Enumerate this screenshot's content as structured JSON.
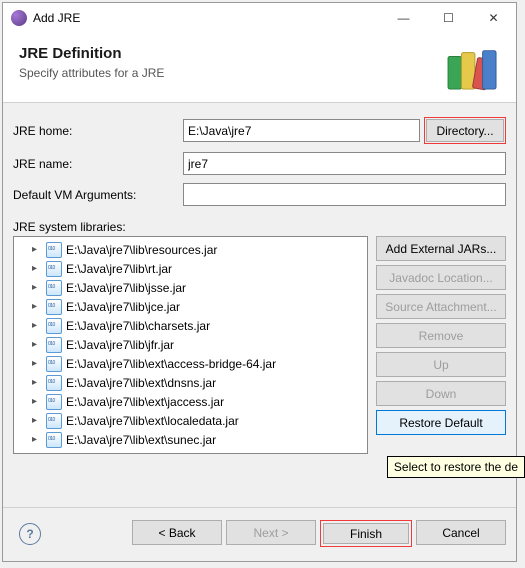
{
  "window": {
    "title": "Add JRE"
  },
  "header": {
    "title": "JRE Definition",
    "subtitle": "Specify attributes for a JRE"
  },
  "form": {
    "jre_home_label": "JRE home:",
    "jre_home_value": "E:\\Java\\jre7",
    "directory_btn": "Directory...",
    "jre_name_label": "JRE name:",
    "jre_name_value": "jre7",
    "vm_args_label": "Default VM Arguments:",
    "vm_args_value": ""
  },
  "syslib": {
    "label": "JRE system libraries:",
    "items": [
      "E:\\Java\\jre7\\lib\\resources.jar",
      "E:\\Java\\jre7\\lib\\rt.jar",
      "E:\\Java\\jre7\\lib\\jsse.jar",
      "E:\\Java\\jre7\\lib\\jce.jar",
      "E:\\Java\\jre7\\lib\\charsets.jar",
      "E:\\Java\\jre7\\lib\\jfr.jar",
      "E:\\Java\\jre7\\lib\\ext\\access-bridge-64.jar",
      "E:\\Java\\jre7\\lib\\ext\\dnsns.jar",
      "E:\\Java\\jre7\\lib\\ext\\jaccess.jar",
      "E:\\Java\\jre7\\lib\\ext\\localedata.jar",
      "E:\\Java\\jre7\\lib\\ext\\sunec.jar"
    ],
    "buttons": {
      "add_ext": "Add External JARs...",
      "javadoc": "Javadoc Location...",
      "source": "Source Attachment...",
      "remove": "Remove",
      "up": "Up",
      "down": "Down",
      "restore": "Restore Default"
    }
  },
  "tooltip": "Select to restore the de",
  "footer": {
    "back": "< Back",
    "next": "Next >",
    "finish": "Finish",
    "cancel": "Cancel"
  }
}
